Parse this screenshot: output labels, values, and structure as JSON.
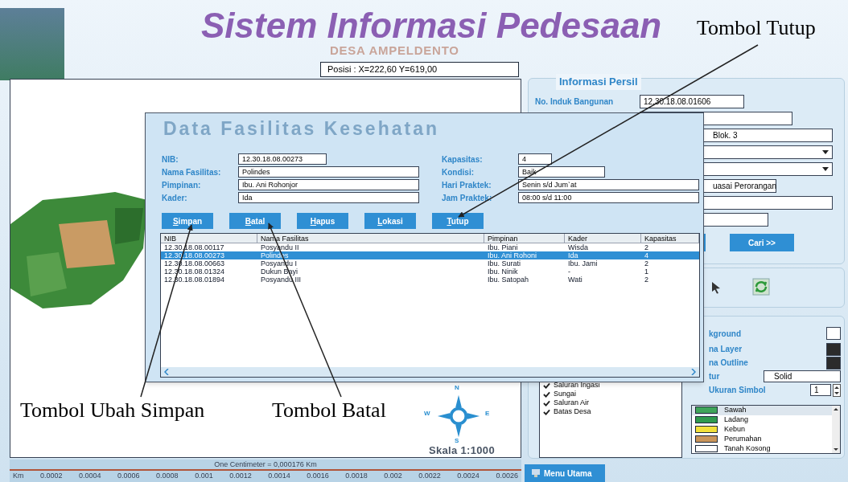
{
  "header": {
    "title": "Sistem Informasi Pedesaan",
    "subtitle": "DESA AMPELDENTO",
    "position": "Posisi : X=222,60  Y=619,00"
  },
  "map": {
    "compass": [
      "N",
      "E",
      "S",
      "W"
    ],
    "scale_label": "Skala 1:1000",
    "scale_caption": "One Centimeter = 0,000176 Km",
    "scale_unit": "Km",
    "scale_ticks": [
      "0.0002",
      "0.0004",
      "0.0006",
      "0.0008",
      "0.001",
      "0.0012",
      "0.0014",
      "0.0016",
      "0.0018",
      "0.002",
      "0.0022",
      "0.0024",
      "0.0026"
    ]
  },
  "persil": {
    "title": "Informasi Persil",
    "fields": [
      {
        "kind": "text",
        "label": "No. Induk Bangunan",
        "value": "12.30.18.08.01606"
      },
      {
        "kind": "text"
      },
      {
        "kind": "text",
        "value": "Blok. 3"
      },
      {
        "kind": "select"
      },
      {
        "kind": "select"
      },
      {
        "kind": "select",
        "value": "uasai Perorangan"
      },
      {
        "kind": "text"
      },
      {
        "kind": "text"
      }
    ],
    "buttons": [
      {
        "kind": "plain"
      },
      {
        "kind": "labeled",
        "label": "Cari >>"
      }
    ]
  },
  "style_panel": {
    "properties": [
      {
        "kind": "color",
        "label": "kground",
        "color": "#ffffff"
      },
      {
        "kind": "color",
        "label": "na Layer",
        "color": "#2b2b2b"
      },
      {
        "kind": "color",
        "label": "na Outline",
        "color": "#2b2b2b"
      },
      {
        "kind": "select",
        "label": "tur",
        "value": "Solid"
      },
      {
        "kind": "spinner",
        "label": "Ukuran Simbol",
        "value": "1"
      }
    ],
    "legend": [
      {
        "label": "Sawah",
        "color": "#3fa55a",
        "selected": true
      },
      {
        "label": "Ladang",
        "color": "#2f9a4e",
        "selected": false
      },
      {
        "label": "Kebun",
        "color": "#f2e03a",
        "selected": false
      },
      {
        "label": "Perumahan",
        "color": "#c9955a",
        "selected": false
      },
      {
        "label": "Tanah Kosong",
        "color": "#ffffff",
        "selected": false
      }
    ]
  },
  "layers": [
    {
      "label": "Saluran Irigasi",
      "checked": true
    },
    {
      "label": "Sungai",
      "checked": true
    },
    {
      "label": "Saluran Air",
      "checked": true
    },
    {
      "label": "Batas Desa",
      "checked": true
    }
  ],
  "menu_button": "Menu Utama",
  "dialog": {
    "title": "Data Fasilitas Kesehatan",
    "fields_left": [
      {
        "label": "NIB:",
        "value": "12.30.18.08.00273"
      },
      {
        "label": "Nama Fasilitas:",
        "value": "Polindes"
      },
      {
        "label": "Pimpinan:",
        "value": "Ibu. Ani Rohonjor"
      },
      {
        "label": "Kader:",
        "value": "Ida"
      }
    ],
    "fields_right": [
      {
        "label": "Kapasitas:",
        "value": "4"
      },
      {
        "label": "Kondisi:",
        "value": "Baik"
      },
      {
        "label": "Hari Praktek:",
        "value": "Senin s/d Jum`at"
      },
      {
        "label": "Jam Praktek:",
        "value": "08:00 s/d 11:00"
      }
    ],
    "buttons": [
      "Simpan",
      "Batal",
      "Hapus",
      "Lokasi",
      "Tutup"
    ],
    "table": {
      "columns": [
        "NIB",
        "Nama Fasilitas",
        "Pimpinan",
        "Kader",
        "Kapasitas"
      ],
      "rows": [
        {
          "cells": [
            "12.30.18.08.00117",
            "Posyandu II",
            "Ibu. Piani",
            "Wisda",
            "2"
          ],
          "selected": false
        },
        {
          "cells": [
            "12.30.18.08.00273",
            "Polindes",
            "Ibu. Ani Rohoni",
            "Ida",
            "4"
          ],
          "selected": true
        },
        {
          "cells": [
            "12.30.18.08.00663",
            "Posyandu I",
            "Ibu. Surati",
            "Ibu. Jami",
            "2"
          ],
          "selected": false
        },
        {
          "cells": [
            "12.30.18.08.01324",
            "Dukun Bayi",
            "Ibu. Ninik",
            "-",
            "1"
          ],
          "selected": false
        },
        {
          "cells": [
            "12.30.18.08.01894",
            "Posyandu III",
            "Ibu. Satopah",
            "Wati",
            "2"
          ],
          "selected": false
        }
      ]
    }
  },
  "annotations": [
    {
      "text": "Tombol Tutup"
    },
    {
      "text": "Tombol Ubah Simpan"
    },
    {
      "text": "Tombol Batal"
    }
  ]
}
